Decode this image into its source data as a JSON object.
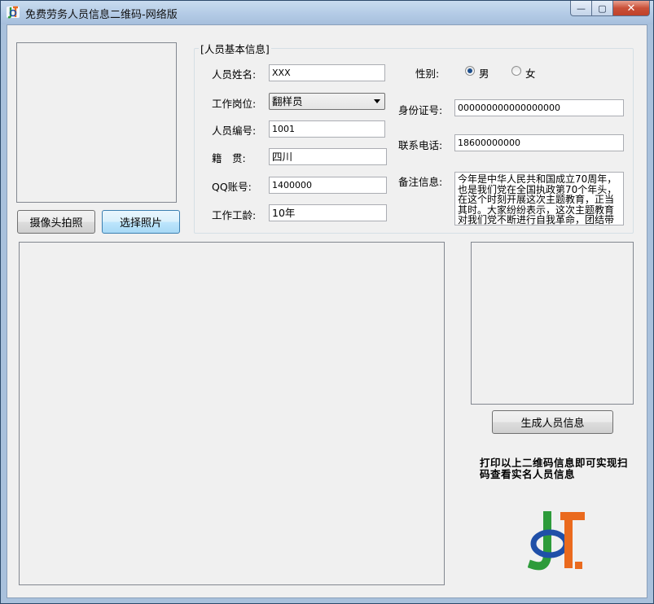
{
  "window": {
    "title": "免费劳务人员信息二维码-网络版",
    "min_glyph": "—",
    "max_glyph": "▢",
    "close_glyph": "✕"
  },
  "photo": {
    "camera_button": "摄像头拍照",
    "select_button": "选择照片"
  },
  "basic_info": {
    "group_title": "[人员基本信息]",
    "name_label": "人员姓名:",
    "name_value": "XXX",
    "gender_label": "性别:",
    "gender_male": "男",
    "gender_female": "女",
    "gender_selected": "男",
    "position_label": "工作岗位:",
    "position_value": "翻样员",
    "id_label": "身份证号:",
    "id_value": "000000000000000000",
    "number_label": "人员编号:",
    "number_value": "1001",
    "phone_label": "联系电话:",
    "phone_value": "18600000000",
    "native_label": "籍　贯:",
    "native_value": "四川",
    "qq_label": "QQ账号:",
    "qq_value": "1400000",
    "remark_label": "备注信息:",
    "remark_value": "今年是中华人民共和国成立70周年，也是我们党在全国执政第70个年头，在这个时刻开展这次主题教育，正当其时。大家纷纷表示，这次主题教育对我们党不断进行自我革命，团结带",
    "seniority_label": "工作工龄:",
    "seniority_value": "10年"
  },
  "actions": {
    "generate_button": "生成人员信息"
  },
  "hint_text": "打印以上二维码信息即可实现扫码查看实名人员信息",
  "colors": {
    "title_bar": "#b4cbe6",
    "client_bg": "#f0f0f0",
    "logo_green": "#2d9b3a",
    "logo_blue": "#1f4fa8",
    "logo_orange": "#ea6a1e",
    "radio_dot": "#1e4f8c"
  },
  "icons": {
    "app": "jf-logo-icon",
    "combo": "chevron-down-icon"
  }
}
